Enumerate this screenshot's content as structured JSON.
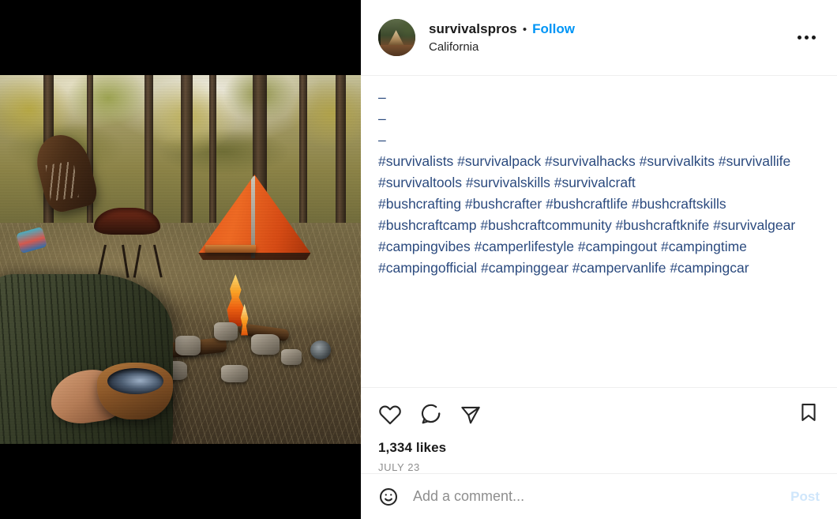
{
  "header": {
    "username": "survivalspros",
    "separator": "•",
    "follow_label": "Follow",
    "location": "California",
    "avatar_alt": "a-frame-cabin-in-forest",
    "more_menu_label": "More options"
  },
  "caption": {
    "lines": [
      "–",
      "",
      "–",
      "",
      "–",
      "#survivalists #survivalpack #survivalhacks #survivalkits #survivallife #survivaltools #survivalskills #survivalcraft",
      "#bushcrafting #bushcrafter #bushcraftlife #bushcraftskills #bushcraftcamp #bushcraftcommunity #bushcraftknife #survivalgear",
      "#campingvibes #camperlifestyle #campingout #campingtime #campingofficial #campinggear #campervanlife #campingcar"
    ]
  },
  "actions": {
    "like_label": "Like",
    "comment_label": "Comment",
    "share_label": "Share",
    "save_label": "Save"
  },
  "meta": {
    "likes": "1,334 likes",
    "date": "JULY 23"
  },
  "composer": {
    "emoji_label": "Emoji",
    "placeholder": "Add a comment...",
    "value": "",
    "post_label": "Post"
  },
  "media": {
    "alt": "campsite-with-orange-tent-and-campfire",
    "letterbox_color": "#000000"
  },
  "colors": {
    "link_blue": "#0095f6",
    "hashtag_blue": "#2b4a7e",
    "muted_gray": "#8e8e8e",
    "divider": "#efefef",
    "post_disabled": "#cfe6fb"
  }
}
